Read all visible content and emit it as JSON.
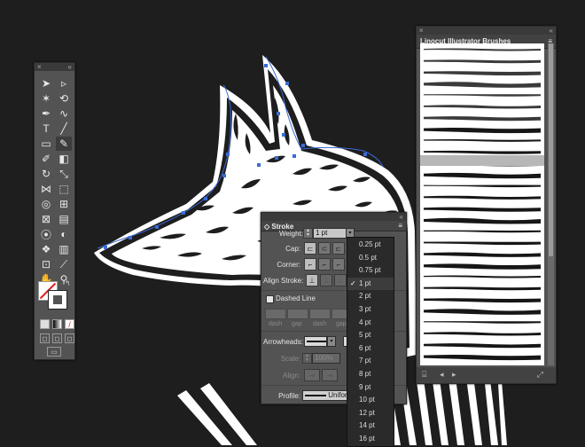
{
  "tools_panel": {
    "tools": [
      "selection-icon",
      "direct-selection-icon",
      "magic-wand-icon",
      "lasso-icon",
      "pen-icon",
      "curvature-icon",
      "type-icon",
      "line-icon",
      "rectangle-icon",
      "paintbrush-icon",
      "shaper-icon",
      "eraser-icon",
      "rotate-icon",
      "scale-icon",
      "width-icon",
      "free-transform-icon",
      "shape-builder-icon",
      "perspective-icon",
      "mesh-icon",
      "gradient-icon",
      "eyedropper-icon",
      "blend-icon",
      "symbol-sprayer-icon",
      "graph-icon",
      "artboard-icon",
      "slice-icon",
      "hand-icon",
      "zoom-icon"
    ],
    "selected_tool": "paintbrush-icon"
  },
  "brushes_panel": {
    "title": "Linocut Illustrator Brushes",
    "selected_index": 9
  },
  "stroke_panel": {
    "title": "Stroke",
    "weight_label": "Weight:",
    "weight_value": "1 pt",
    "cap_label": "Cap:",
    "corner_label": "Corner:",
    "align_label": "Align Stroke:",
    "dashed_label": "Dashed Line",
    "dash_labels": [
      "dash",
      "gap",
      "dash",
      "gap"
    ],
    "arrowheads_label": "Arrowheads:",
    "scale_label": "Scale:",
    "scale_value": "100%",
    "align2_label": "Align:",
    "profile_label": "Profile:",
    "profile_value": "Uniform"
  },
  "weight_dropdown": {
    "options": [
      "0.25 pt",
      "0.5 pt",
      "0.75 pt",
      "1 pt",
      "2 pt",
      "3 pt",
      "4 pt",
      "5 pt",
      "6 pt",
      "7 pt",
      "8 pt",
      "9 pt",
      "10 pt",
      "12 pt",
      "14 pt",
      "16 pt"
    ],
    "selected": "1 pt"
  },
  "colors": {
    "background": "#1e1e1e",
    "panel": "#535353",
    "path": "#3a6bd6"
  }
}
